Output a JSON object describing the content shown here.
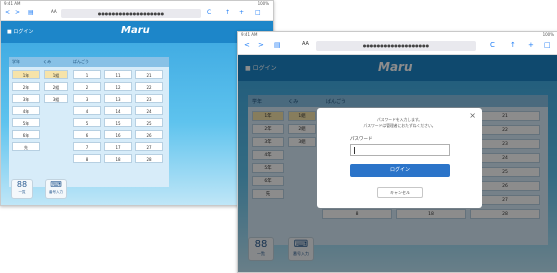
{
  "browser": {
    "status_left": "9:41 AM",
    "status_right": "100%",
    "url_back": "<",
    "url_forward": ">",
    "book_icon": "book-icon",
    "aa": "AA",
    "url": "●●●●●●●●●●●●●●●●●●●",
    "reload": "C",
    "share": "↑",
    "plus": "+",
    "tabs": "□"
  },
  "app": {
    "header_title": "■ ログイン",
    "logo": "Maru",
    "panel_header_class": "学年",
    "panel_header_group": "くみ",
    "panel_header_right": "ばんごう",
    "grades": [
      "1年",
      "2年",
      "3年",
      "4年",
      "5年",
      "6年",
      "先"
    ],
    "groups": [
      "1組",
      "2組",
      "3組"
    ],
    "numbers": [
      [
        "1",
        "11",
        "21"
      ],
      [
        "2",
        "12",
        "22"
      ],
      [
        "3",
        "13",
        "23"
      ],
      [
        "4",
        "14",
        "24"
      ],
      [
        "5",
        "15",
        "25"
      ],
      [
        "6",
        "16",
        "26"
      ],
      [
        "7",
        "17",
        "27"
      ],
      [
        "8",
        "18",
        "28"
      ]
    ],
    "nav_left": "一覧",
    "nav_right": "番号入力"
  },
  "dialog": {
    "message_line1": "パスワードを入力します。",
    "message_line2": "パスワードは管理者におたずねください。",
    "password_label": "パスワード",
    "password_value": "",
    "login_button": "ログイン",
    "cancel_button": "キャンセル",
    "close": "×"
  },
  "colors": {
    "accent": "#2b74c9",
    "header": "#1d86c9",
    "selected": "#f6e3a9"
  }
}
